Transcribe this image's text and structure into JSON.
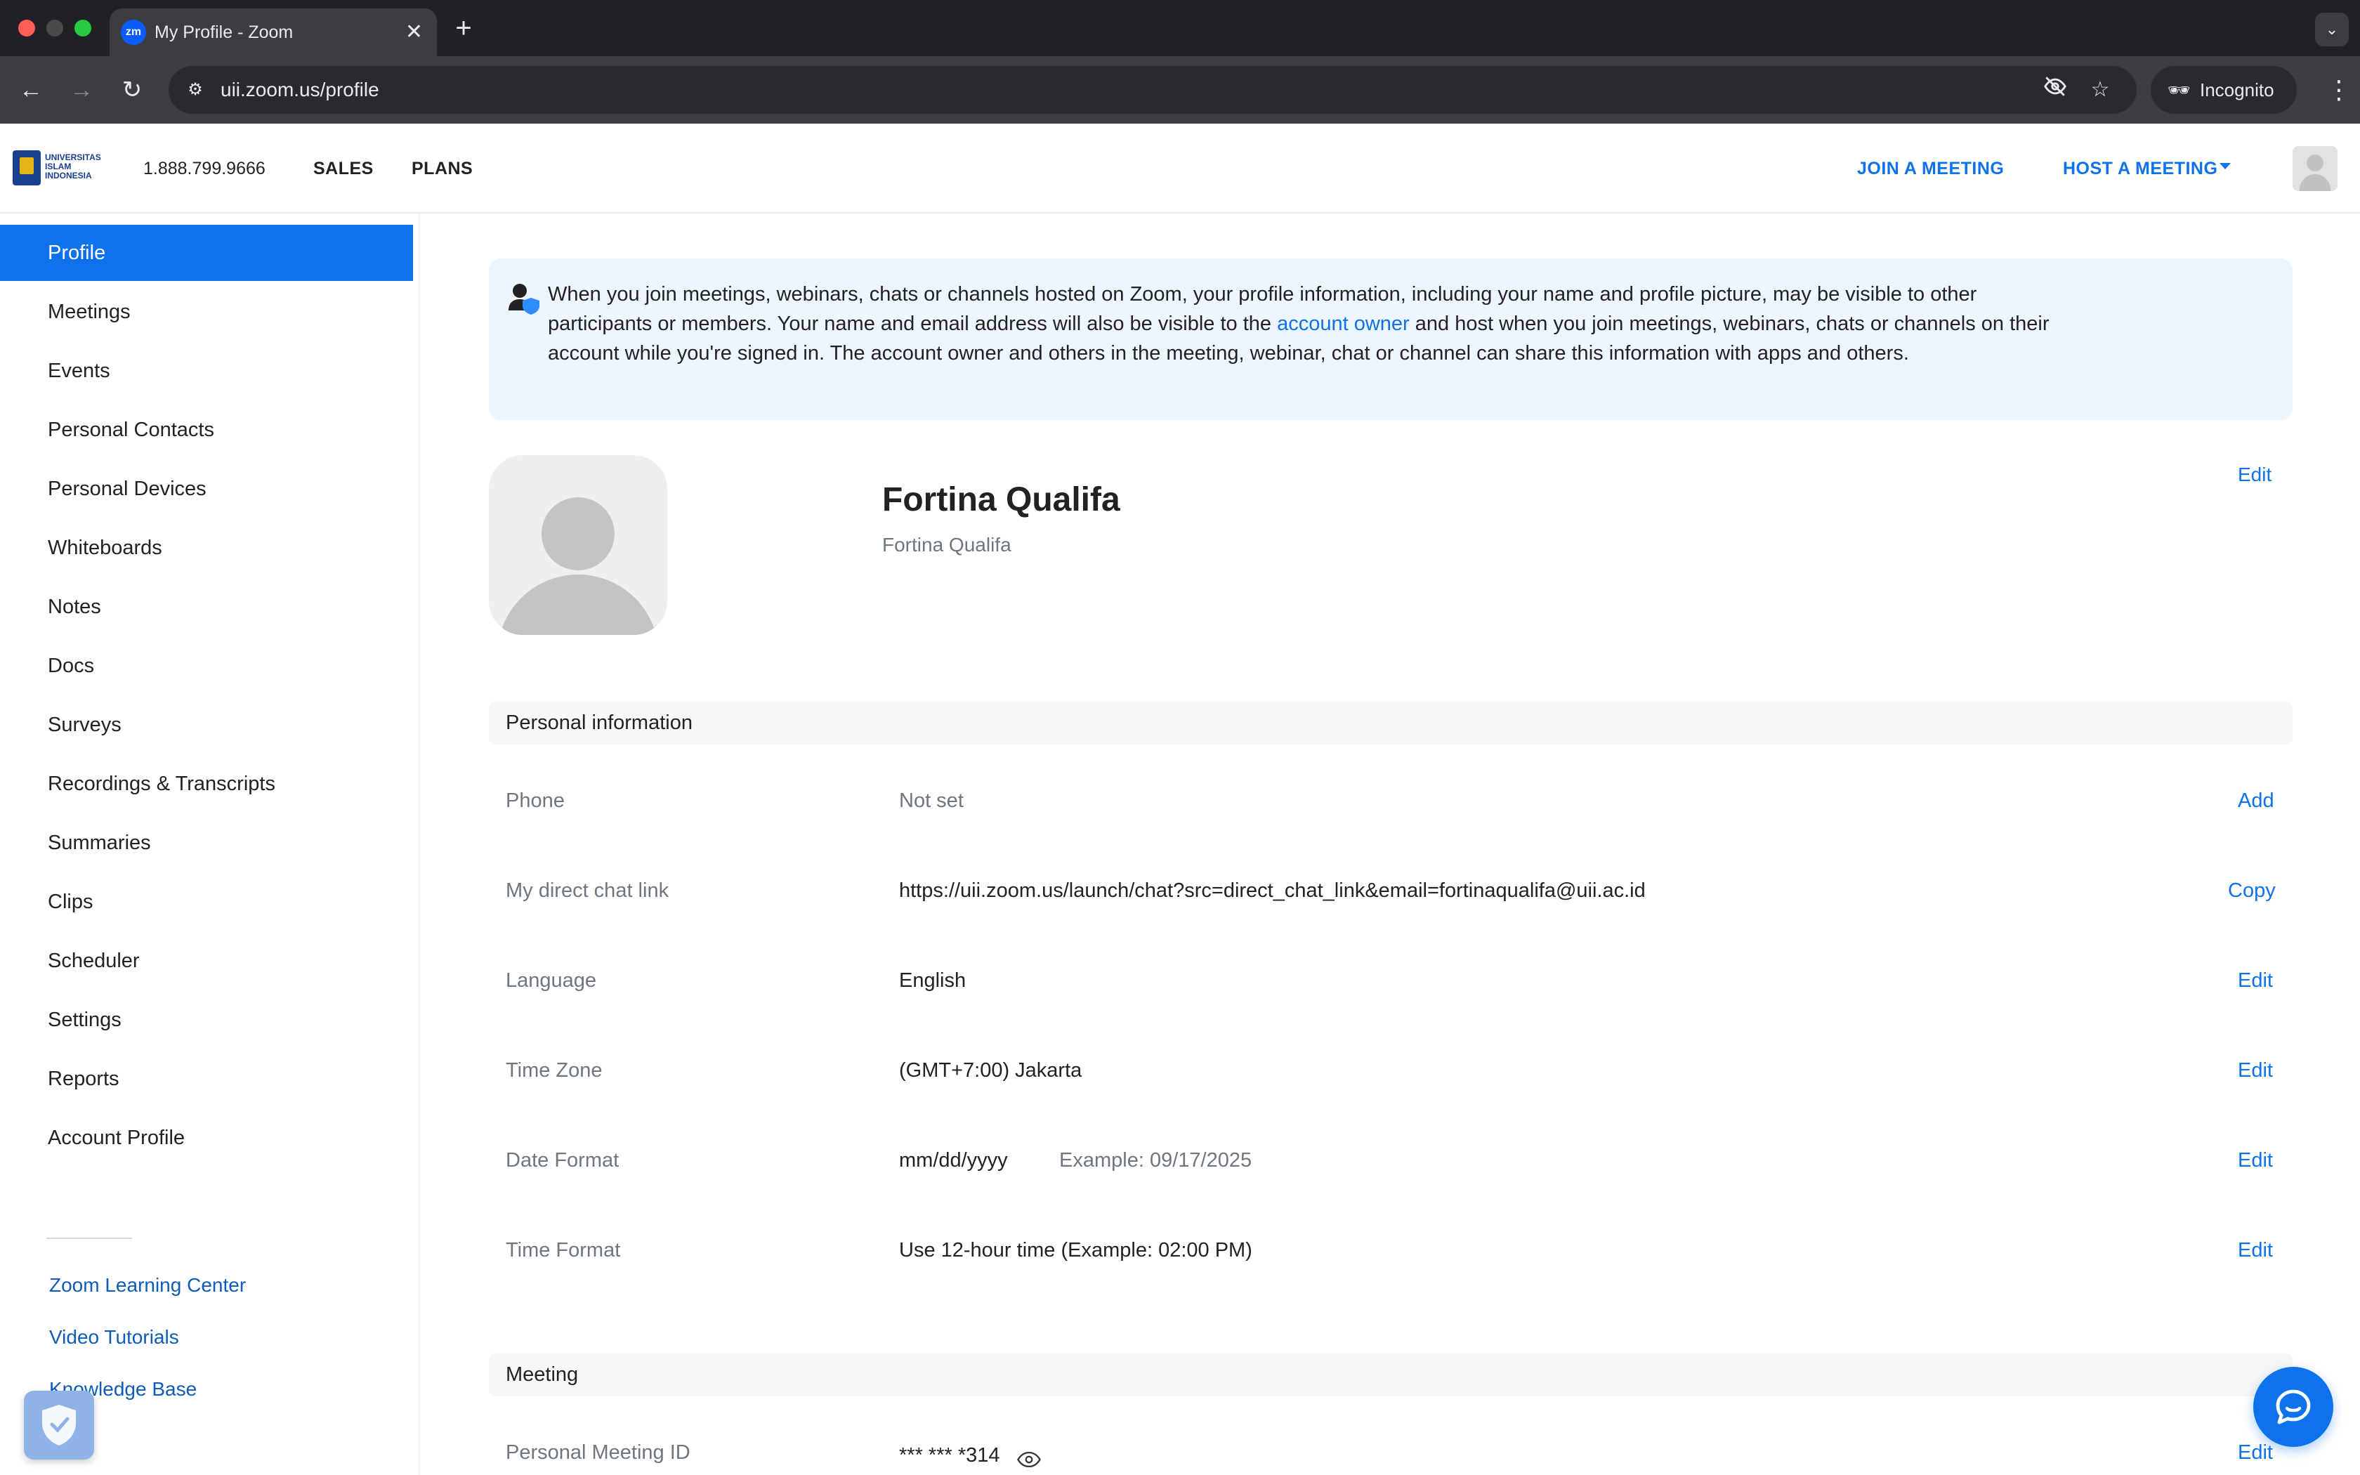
{
  "browser": {
    "tab_title": "My Profile - Zoom",
    "tab_favicon": "zm",
    "url": "uii.zoom.us/profile",
    "incognito_label": "Incognito"
  },
  "header": {
    "logo_lines": [
      "UNIVERSITAS",
      "ISLAM",
      "INDONESIA"
    ],
    "phone": "1.888.799.9666",
    "sales": "SALES",
    "plans": "PLANS",
    "join": "JOIN A MEETING",
    "host": "HOST A MEETING"
  },
  "sidebar": {
    "items": [
      {
        "label": "Profile",
        "active": true
      },
      {
        "label": "Meetings"
      },
      {
        "label": "Events"
      },
      {
        "label": "Personal Contacts"
      },
      {
        "label": "Personal Devices"
      },
      {
        "label": "Whiteboards"
      },
      {
        "label": "Notes"
      },
      {
        "label": "Docs"
      },
      {
        "label": "Surveys"
      },
      {
        "label": "Recordings & Transcripts"
      },
      {
        "label": "Summaries"
      },
      {
        "label": "Clips"
      },
      {
        "label": "Scheduler"
      },
      {
        "label": "Settings"
      },
      {
        "label": "Reports"
      },
      {
        "label": "Account Profile"
      }
    ],
    "links": [
      "Zoom Learning Center",
      "Video Tutorials",
      "Knowledge Base"
    ]
  },
  "notice": {
    "text_before": "When you join meetings, webinars, chats or channels hosted on Zoom, your profile information, including your name and profile picture, may be visible to other participants or members. Your name and email address will also be visible to the ",
    "link": "account owner",
    "text_after": " and host when you join meetings, webinars, chats or channels on their account while you're signed in. The account owner and others in the meeting, webinar, chat or channel can share this information with apps and others."
  },
  "profile": {
    "name": "Fortina Qualifa",
    "display_name": "Fortina Qualifa",
    "edit": "Edit"
  },
  "personal_info": {
    "title": "Personal information",
    "rows": [
      {
        "label": "Phone",
        "value": "Not set",
        "action": "Add"
      },
      {
        "label": "My direct chat link",
        "value": "https://uii.zoom.us/launch/chat?src=direct_chat_link&email=fortinaqualifa@uii.ac.id",
        "action": "Copy"
      },
      {
        "label": "Language",
        "value": "English",
        "action": "Edit"
      },
      {
        "label": "Time Zone",
        "value": "(GMT+7:00) Jakarta",
        "action": "Edit"
      },
      {
        "label": "Date Format",
        "value": "mm/dd/yyyy",
        "example": "Example: 09/17/2025",
        "action": "Edit"
      },
      {
        "label": "Time Format",
        "value": "Use 12-hour time (Example: 02:00 PM)",
        "action": "Edit"
      }
    ]
  },
  "meeting": {
    "title": "Meeting",
    "rows": [
      {
        "label": "Personal Meeting ID",
        "value": "*** *** *314",
        "action": "Edit"
      }
    ]
  },
  "colors": {
    "accent": "#0e72ed",
    "chrome_dark": "#202124",
    "notice_bg": "#edf5ff"
  },
  "icons": [
    "site-info-icon",
    "eye-slash-icon",
    "star-icon",
    "incognito-icon",
    "user-shield-icon",
    "eye-icon",
    "shield-check-icon",
    "chat-bubble-icon"
  ]
}
